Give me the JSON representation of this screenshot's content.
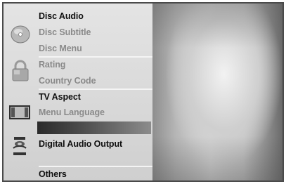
{
  "menu": {
    "groups": [
      {
        "icon": "disc-icon",
        "items": [
          "Disc Audio",
          "Disc Subtitle",
          "Disc Menu"
        ]
      },
      {
        "icon": "lock-icon",
        "items": [
          "Rating",
          "Country Code"
        ]
      },
      {
        "icon": "tv-screen-icon",
        "items": [
          "TV Aspect",
          "Menu Language"
        ]
      },
      {
        "icon": "speaker-icon",
        "items": [
          "Digital Audio Output"
        ]
      },
      {
        "icon": "",
        "items": [
          "Others"
        ]
      }
    ]
  }
}
